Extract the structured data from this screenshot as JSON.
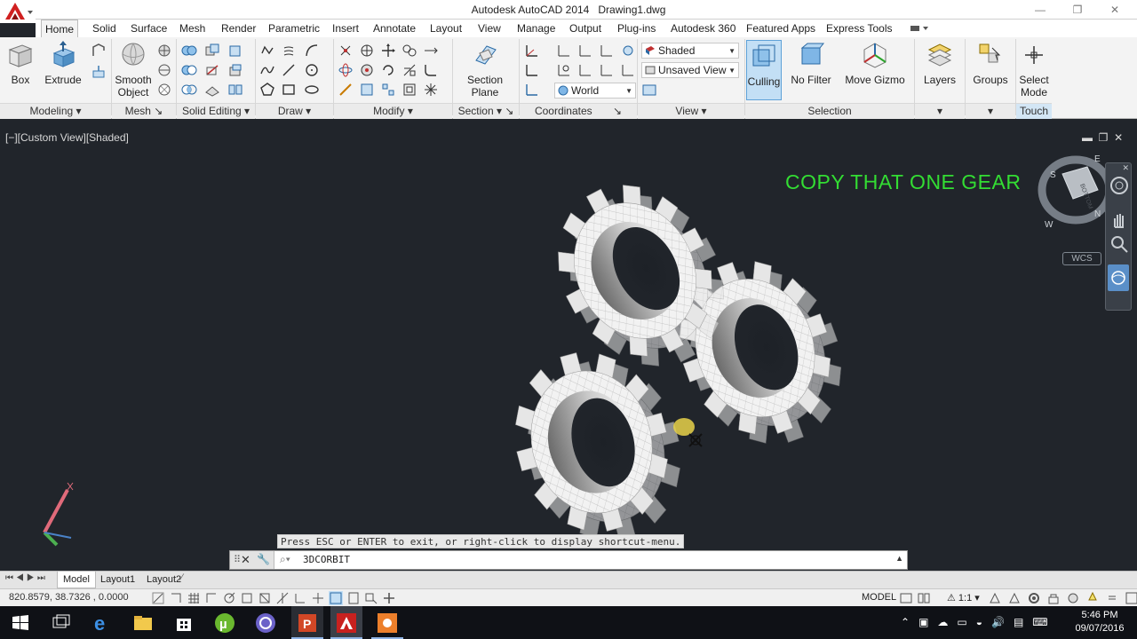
{
  "window": {
    "app_name": "Autodesk AutoCAD 2014",
    "document": "Drawing1.dwg",
    "minimize": "—",
    "restore": "❐",
    "close": "✕"
  },
  "ribbon_tabs": [
    {
      "label": "Home"
    },
    {
      "label": "Solid"
    },
    {
      "label": "Surface"
    },
    {
      "label": "Mesh"
    },
    {
      "label": "Render"
    },
    {
      "label": "Parametric"
    },
    {
      "label": "Insert"
    },
    {
      "label": "Annotate"
    },
    {
      "label": "Layout"
    },
    {
      "label": "View"
    },
    {
      "label": "Manage"
    },
    {
      "label": "Output"
    },
    {
      "label": "Plug-ins"
    },
    {
      "label": "Autodesk 360"
    },
    {
      "label": "Featured Apps"
    },
    {
      "label": "Express Tools"
    }
  ],
  "ribbon": {
    "box": "Box",
    "extrude": "Extrude",
    "smooth_object": "Smooth\nObject",
    "section_plane": "Section\nPlane",
    "culling": "Culling",
    "no_filter": "No Filter",
    "move_gizmo": "Move Gizmo",
    "layers": "Layers",
    "groups": "Groups",
    "select_mode": "Select\nMode",
    "visual_style": "Shaded",
    "named_view": "Unsaved View",
    "ucs": "World",
    "panels": {
      "modeling": "Modeling",
      "mesh": "Mesh",
      "solid_editing": "Solid Editing",
      "draw": "Draw",
      "modify": "Modify",
      "section": "Section",
      "coordinates": "Coordinates",
      "view": "View",
      "selection": "Selection",
      "touch": "Touch"
    }
  },
  "viewport": {
    "label": "[−][Custom View][Shaded]",
    "overlay_text": "COPY THAT ONE GEAR",
    "wcs": "WCS",
    "viewcube_face": "BOTTOM",
    "compass": [
      "S",
      "E",
      "W",
      "N"
    ]
  },
  "command": {
    "hint": "Press ESC or ENTER to exit, or right-click to display shortcut-menu.",
    "current": "3DCORBIT"
  },
  "layouts": [
    "Model",
    "Layout1",
    "Layout2"
  ],
  "status": {
    "coords": "820.8579, 38.7326 , 0.0000",
    "space": "MODEL",
    "scale": "1:1"
  },
  "taskbar": {
    "time": "5:46 PM",
    "date": "09/07/2016"
  },
  "colors": {
    "viewport_bg": "#21252b",
    "overlay_text": "#33dd33",
    "accent": "#0078d7",
    "gear_face": "#f2f2f2"
  }
}
